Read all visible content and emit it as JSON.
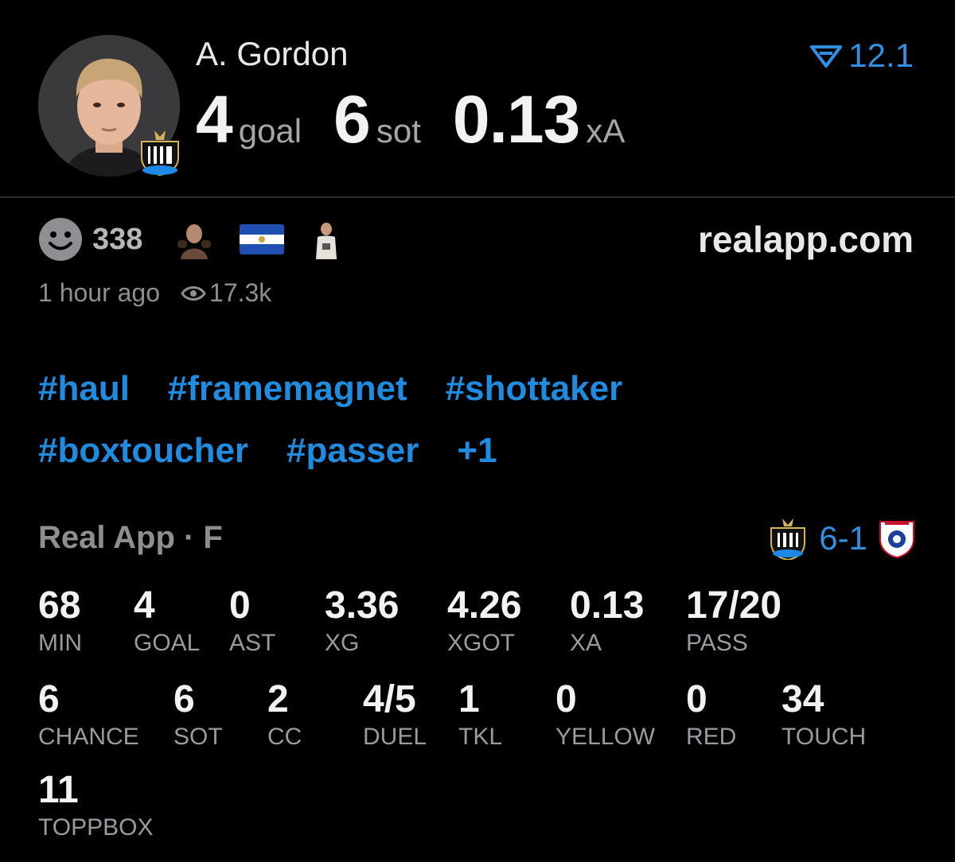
{
  "player": {
    "name": "A. Gordon",
    "rating": "12.1",
    "key_stats": [
      {
        "value": "4",
        "label": "goal"
      },
      {
        "value": "6",
        "label": "sot"
      },
      {
        "value": "0.13",
        "label": "xA"
      }
    ]
  },
  "post": {
    "reaction_count": "338",
    "site": "realapp.com",
    "time_ago": "1 hour ago",
    "views": "17.3k"
  },
  "tags": [
    [
      "#haul",
      "#framemagnet",
      "#shottaker"
    ],
    [
      "#boxtoucher",
      "#passer",
      "+1"
    ]
  ],
  "match": {
    "competition": "Real App · F",
    "score": "6-1"
  },
  "stats": [
    {
      "value": "68",
      "label": "MIN"
    },
    {
      "value": "4",
      "label": "GOAL"
    },
    {
      "value": "0",
      "label": "AST"
    },
    {
      "value": "3.36",
      "label": "XG"
    },
    {
      "value": "4.26",
      "label": "XGOT"
    },
    {
      "value": "0.13",
      "label": "XA"
    },
    {
      "value": "17/20",
      "label": "PASS"
    },
    {
      "value": "6",
      "label": "CHANCE"
    },
    {
      "value": "6",
      "label": "SOT"
    },
    {
      "value": "2",
      "label": "CC"
    },
    {
      "value": "4/5",
      "label": "DUEL"
    },
    {
      "value": "1",
      "label": "TKL"
    },
    {
      "value": "0",
      "label": "YELLOW"
    },
    {
      "value": "0",
      "label": "RED"
    },
    {
      "value": "34",
      "label": "TOUCH"
    },
    {
      "value": "11",
      "label": "TOPPBOX"
    }
  ],
  "colors": {
    "accent": "#2f8fe0",
    "tag": "#1f8ce0",
    "background": "#000000",
    "muted": "#8e8e93"
  }
}
